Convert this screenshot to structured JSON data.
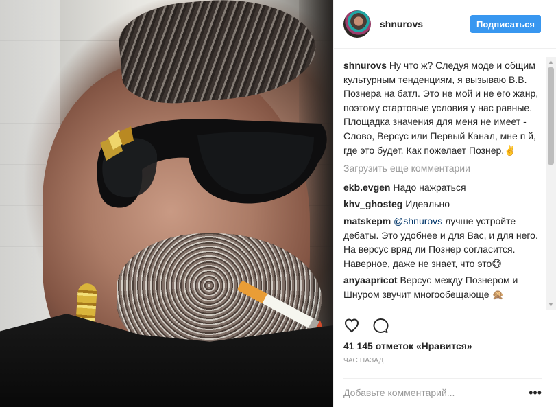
{
  "post": {
    "username": "shnurovs",
    "follow_label": "Подписаться",
    "caption": {
      "author": "shnurovs",
      "text": "Ну что ж? Следуя моде и общим культурным тенденциям, я вызываю В.В. Познера на батл. Это не мой и не его жанр, поэтому стартовые условия у нас равные. Площадка значения для меня не имеет - Слово, Версус или Первый Канал, мне п  й, где это будет. Как пожелает Познер.✌️"
    },
    "load_more_label": "Загрузить еще комментарии",
    "comments": [
      {
        "author": "ekb.evgen",
        "text": "Надо нажраться"
      },
      {
        "author": "khv_ghosteg",
        "text": "Идеально"
      },
      {
        "author": "matskepm",
        "mention": "@shnurovs",
        "text": "лучше устройте дебаты. Это удобнее и для Вас, и для него. На версус вряд ли Познер согласится. Наверное, даже не знает, что это😅"
      },
      {
        "author": "anyaapricot",
        "text": "Версус между Познером и Шнуром звучит многообещающе 🙊"
      }
    ],
    "likes_text": "41 145 отметок «Нравится»",
    "timestamp": "ЧАС НАЗАД",
    "comment_placeholder": "Добавьте комментарий...",
    "icons": {
      "like": "heart-icon",
      "comment": "comment-icon",
      "more": "more-options-icon"
    },
    "colors": {
      "accent": "#3897f0",
      "text": "#262626",
      "muted": "#999999",
      "border": "#efefef"
    }
  }
}
